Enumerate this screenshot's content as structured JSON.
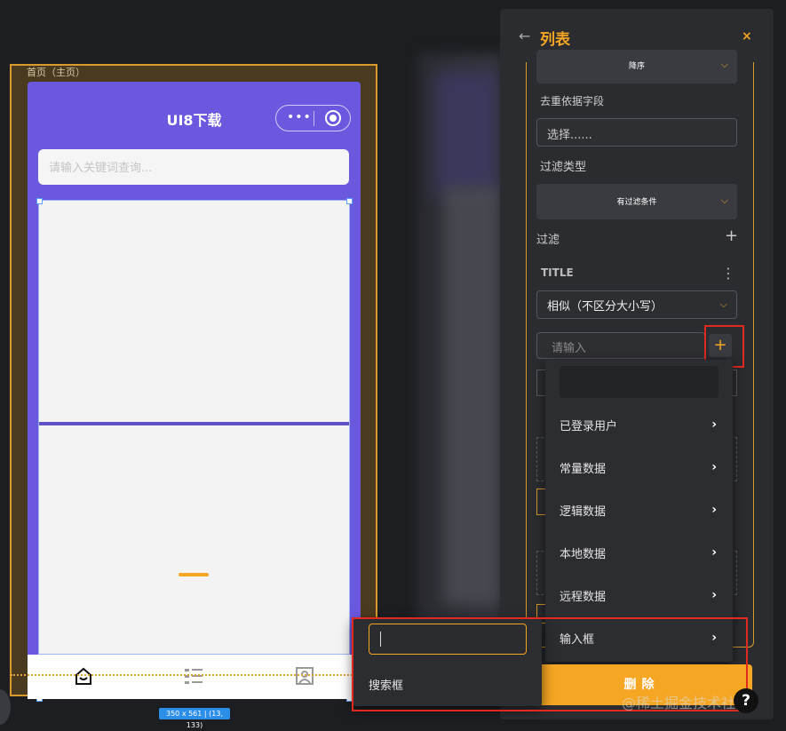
{
  "canvas": {
    "page_label": "首页（主页）",
    "phone_title": "UI8下载",
    "capsule_dots": "•••",
    "search_placeholder": "请输入关键词查询...",
    "size_tag": "350 x 561 | (13, 133)",
    "tab_icons": [
      "home-icon",
      "list-icon",
      "profile-icon"
    ]
  },
  "panel": {
    "title": "列表",
    "back_glyph": "←",
    "close_glyph": "×",
    "sort_value": "降序",
    "dedupe_label": "去重依据字段",
    "dedupe_placeholder": "选择......",
    "filter_type_label": "过滤类型",
    "filter_type_value": "有过滤条件",
    "filter_label": "过滤",
    "filter_add": "+",
    "field_name": "TITLE",
    "field_more": "⋮",
    "match_mode": "相似（不区分大小写）",
    "value_placeholder": "请输入",
    "value_add": "+",
    "delete_label": "删除"
  },
  "menu": {
    "items": [
      {
        "label": "已登录用户",
        "arrow": "›"
      },
      {
        "label": "常量数据",
        "arrow": "›"
      },
      {
        "label": "逻辑数据",
        "arrow": "›"
      },
      {
        "label": "本地数据",
        "arrow": "›"
      },
      {
        "label": "远程数据",
        "arrow": "›"
      },
      {
        "label": "输入框",
        "arrow": "›"
      }
    ]
  },
  "submenu": {
    "input_value": "",
    "item": "搜索框"
  },
  "overlay": {
    "watermark": "@稀土掘金技术社区",
    "help": "?"
  },
  "colors": {
    "accent": "#f5a623",
    "phone_bg": "#6a59df",
    "highlight": "#e0291f"
  }
}
